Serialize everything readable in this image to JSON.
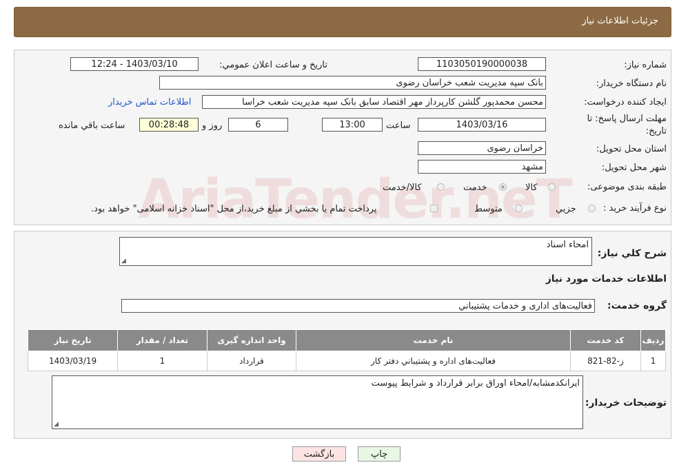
{
  "header": {
    "title": "جزئیات اطلاعات نیاز"
  },
  "form": {
    "need_number_label": "شماره نیاز:",
    "need_number": "1103050190000038",
    "announce_label": "تاریخ و ساعت اعلان عمومي:",
    "announce_value": "1403/03/10 - 12:24",
    "buyer_org_label": "نام دستگاه خريدار:",
    "buyer_org": "بانک سپه مديريت شعب خراسان رضوی",
    "creator_label": "ايجاد کننده درخواست:",
    "creator": "محسن محمدپور گلشن کارپرداز مهر اقتصاد سابق بانک سپه مديريت شعب خراسا",
    "contact_link": "اطلاعات تماس خريدار",
    "deadline_label": "مهلت ارسال پاسخ: تا",
    "deadline_label2": "تاريخ:",
    "deadline_date": "1403/03/16",
    "time_label": "ساعت",
    "deadline_time": "13:00",
    "days_value": "6",
    "days_label": "روز و",
    "remaining_value": "00:28:48",
    "remaining_label": "ساعت باقي مانده",
    "province_label": "استان محل تحويل:",
    "province": "خراسان رضوی",
    "city_label": "شهر محل تحويل:",
    "city": "مشهد",
    "category_label": "طبقه بندی موضوعی:",
    "category_options": [
      {
        "label": "کالا",
        "selected": false
      },
      {
        "label": "خدمت",
        "selected": true
      },
      {
        "label": "کالا/خدمت",
        "selected": false
      }
    ],
    "process_label": "نوع فرآيند خريد :",
    "process_options": [
      {
        "label": "جزيي",
        "selected": false
      },
      {
        "label": "متوسط",
        "selected": false
      }
    ],
    "process_note": "پرداخت تمام يا بخشي از مبلغ خريد،از محل \"اسناد خزانه اسلامی\" خواهد بود."
  },
  "details": {
    "summary_label": "شرح کلي نياز:",
    "summary": "امحاء اسناد",
    "services_title": "اطلاعات خدمات مورد نياز",
    "service_group_label": "گروه خدمت:",
    "service_group": "فعاليت‌های اداری و خدمات پشتيباني",
    "table": {
      "headers": [
        "رديف",
        "کد خدمت",
        "نام خدمت",
        "واحد اندازه گيری",
        "تعداد / مقدار",
        "تاريخ نياز"
      ],
      "rows": [
        [
          "1",
          "ز-82-821",
          "فعاليت‌های اداره و پشتيباني دفتر کار",
          "قرارداد",
          "1",
          "1403/03/19"
        ]
      ]
    },
    "buyer_notes_label": "توضيحات خريدار:",
    "buyer_notes": "ايرانکدمشابه/امحاء اوراق برابر قرارداد و شرايط پيوست"
  },
  "buttons": {
    "print": "چاپ",
    "back": "بازگشت"
  },
  "watermark": "AriaTender.neT"
}
